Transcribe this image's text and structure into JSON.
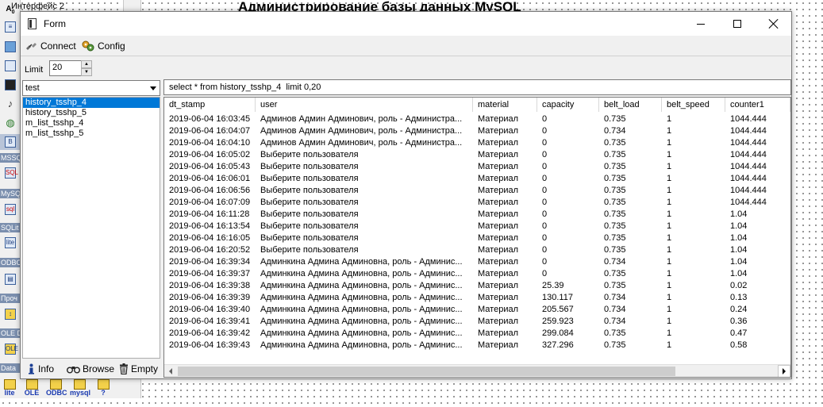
{
  "background": {
    "page_title": "Администрирование базы данных MySQL",
    "ide_tab_label": "Интерфейс 2",
    "palette_categories": [
      "MSSQ",
      "MySQ",
      "SQLit",
      "ODBC",
      "Проч",
      "OLE D",
      "Data"
    ],
    "bottom_palette": [
      "lite",
      "OLE",
      "ODBC",
      "mysql",
      "?"
    ]
  },
  "window": {
    "title": "Form",
    "minimize_icon": "minimize-icon",
    "maximize_icon": "maximize-icon",
    "close_icon": "close-icon"
  },
  "toolbar": {
    "connect_label": "Connect",
    "config_label": "Config"
  },
  "limit": {
    "label": "Limit",
    "value": "20"
  },
  "database_select": {
    "value": "test"
  },
  "tables": [
    "history_tsshp_4",
    "history_tsshp_5",
    "m_list_tsshp_4",
    "m_list_tsshp_5"
  ],
  "selected_table_index": 0,
  "query": "select * from history_tsshp_4  limit 0,20",
  "grid": {
    "columns": [
      "dt_stamp",
      "user",
      "material",
      "capacity",
      "belt_load",
      "belt_speed",
      "counter1"
    ],
    "rows": [
      [
        "2019-06-04 16:03:45",
        "Админов Админ Админович, роль - Администра...",
        "Материал",
        "0",
        "0.735",
        "1",
        "1044.444"
      ],
      [
        "2019-06-04 16:04:07",
        "Админов Админ Админович, роль - Администра...",
        "Материал",
        "0",
        "0.734",
        "1",
        "1044.444"
      ],
      [
        "2019-06-04 16:04:10",
        "Админов Админ Админович, роль - Администра...",
        "Материал",
        "0",
        "0.735",
        "1",
        "1044.444"
      ],
      [
        "2019-06-04 16:05:02",
        "Выберите пользователя",
        "Материал",
        "0",
        "0.735",
        "1",
        "1044.444"
      ],
      [
        "2019-06-04 16:05:43",
        "Выберите пользователя",
        "Материал",
        "0",
        "0.735",
        "1",
        "1044.444"
      ],
      [
        "2019-06-04 16:06:01",
        "Выберите пользователя",
        "Материал",
        "0",
        "0.735",
        "1",
        "1044.444"
      ],
      [
        "2019-06-04 16:06:56",
        "Выберите пользователя",
        "Материал",
        "0",
        "0.735",
        "1",
        "1044.444"
      ],
      [
        "2019-06-04 16:07:09",
        "Выберите пользователя",
        "Материал",
        "0",
        "0.735",
        "1",
        "1044.444"
      ],
      [
        "2019-06-04 16:11:28",
        "Выберите пользователя",
        "Материал",
        "0",
        "0.735",
        "1",
        "1.04"
      ],
      [
        "2019-06-04 16:13:54",
        "Выберите пользователя",
        "Материал",
        "0",
        "0.735",
        "1",
        "1.04"
      ],
      [
        "2019-06-04 16:16:05",
        "Выберите пользователя",
        "Материал",
        "0",
        "0.735",
        "1",
        "1.04"
      ],
      [
        "2019-06-04 16:20:52",
        "Выберите пользователя",
        "Материал",
        "0",
        "0.735",
        "1",
        "1.04"
      ],
      [
        "2019-06-04 16:39:34",
        "Админкина Админа Админовна, роль - Админис...",
        "Материал",
        "0",
        "0.734",
        "1",
        "1.04"
      ],
      [
        "2019-06-04 16:39:37",
        "Админкина Админа Админовна, роль - Админис...",
        "Материал",
        "0",
        "0.735",
        "1",
        "1.04"
      ],
      [
        "2019-06-04 16:39:38",
        "Админкина Админа Админовна, роль - Админис...",
        "Материал",
        "25.39",
        "0.735",
        "1",
        "0.02"
      ],
      [
        "2019-06-04 16:39:39",
        "Админкина Админа Админовна, роль - Админис...",
        "Материал",
        "130.117",
        "0.734",
        "1",
        "0.13"
      ],
      [
        "2019-06-04 16:39:40",
        "Админкина Админа Админовна, роль - Админис...",
        "Материал",
        "205.567",
        "0.734",
        "1",
        "0.24"
      ],
      [
        "2019-06-04 16:39:41",
        "Админкина Админа Админовна, роль - Админис...",
        "Материал",
        "259.923",
        "0.734",
        "1",
        "0.36"
      ],
      [
        "2019-06-04 16:39:42",
        "Админкина Админа Админовна, роль - Админис...",
        "Материал",
        "299.084",
        "0.735",
        "1",
        "0.47"
      ],
      [
        "2019-06-04 16:39:43",
        "Админкина Админа Админовна, роль - Админис...",
        "Материал",
        "327.296",
        "0.735",
        "1",
        "0.58"
      ]
    ]
  },
  "bottom_buttons": {
    "info_label": "Info",
    "browse_label": "Browse",
    "empty_label": "Empty"
  },
  "colors": {
    "selection": "#0078d7",
    "window_bg": "#f0f0f0"
  }
}
